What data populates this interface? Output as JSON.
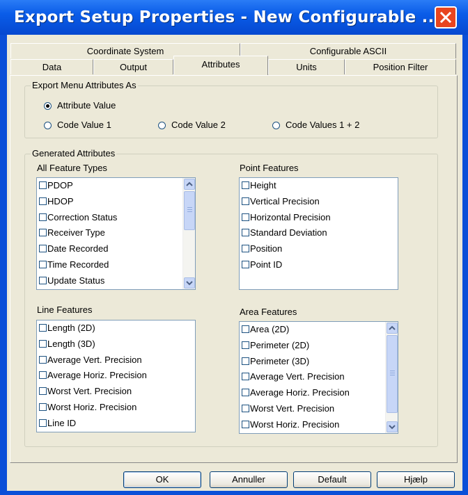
{
  "window": {
    "title": "Export Setup Properties - New Configurable ...",
    "close_label": "X"
  },
  "tabs": {
    "row1": [
      {
        "label": "Coordinate System"
      },
      {
        "label": "Configurable ASCII"
      }
    ],
    "row2": [
      {
        "label": "Data"
      },
      {
        "label": "Output"
      },
      {
        "label": "Attributes",
        "active": true
      },
      {
        "label": "Units"
      },
      {
        "label": "Position Filter"
      }
    ]
  },
  "export_menu": {
    "legend": "Export Menu Attributes As",
    "options": [
      {
        "label": "Attribute Value",
        "selected": true
      },
      {
        "label": "Code Value 1",
        "selected": false
      },
      {
        "label": "Code Value 2",
        "selected": false
      },
      {
        "label": "Code Values 1 + 2",
        "selected": false
      }
    ]
  },
  "generated": {
    "legend": "Generated Attributes",
    "all_features": {
      "label": "All Feature Types",
      "items": [
        "PDOP",
        "HDOP",
        "Correction Status",
        "Receiver Type",
        "Date Recorded",
        "Time Recorded",
        "Update Status"
      ]
    },
    "point_features": {
      "label": "Point Features",
      "items": [
        "Height",
        "Vertical Precision",
        "Horizontal Precision",
        "Standard Deviation",
        "Position",
        "Point ID"
      ]
    },
    "line_features": {
      "label": "Line Features",
      "items": [
        "Length (2D)",
        "Length (3D)",
        "Average Vert. Precision",
        "Average Horiz. Precision",
        "Worst Vert. Precision",
        "Worst Horiz. Precision",
        "Line ID"
      ]
    },
    "area_features": {
      "label": "Area Features",
      "items": [
        "Area (2D)",
        "Perimeter (2D)",
        "Perimeter (3D)",
        "Average Vert. Precision",
        "Average Horiz. Precision",
        "Worst Vert. Precision",
        "Worst Horiz. Precision"
      ]
    }
  },
  "buttons": {
    "ok": "OK",
    "cancel": "Annuller",
    "default": "Default",
    "help": "Hjælp"
  },
  "colors": {
    "titlebar": "#0a5ce8",
    "face": "#ece9d8",
    "close": "#e8451f"
  }
}
